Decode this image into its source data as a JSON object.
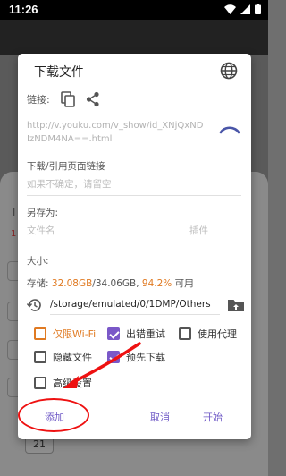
{
  "status_bar": {
    "time": "11:26"
  },
  "dialog": {
    "title": "下载文件",
    "link_label": "链接:",
    "url": "http://v.youku.com/v_show/id_XNjQxNDIzNDM4NA==.html",
    "referer_label": "下载/引用页面链接",
    "referer_placeholder": "如果不确定，请留空",
    "save_as_label": "另存为:",
    "filename_placeholder": "文件名",
    "plugin_placeholder": "插件",
    "size_label": "大小:",
    "storage": {
      "prefix": "存储: ",
      "free": "32.08GB",
      "total": "/34.06GB, ",
      "percent": "94.2%",
      "suffix": " 可用"
    },
    "path": "/storage/emulated/0/1DMP/Others",
    "options": {
      "wifi_only": {
        "label": "仅限Wi-Fi",
        "checked": false
      },
      "retry_on_error": {
        "label": "出错重试",
        "checked": true
      },
      "use_proxy": {
        "label": "使用代理",
        "checked": false
      },
      "hide_file": {
        "label": "隐藏文件",
        "checked": false
      },
      "pre_download": {
        "label": "预先下载",
        "checked": true
      },
      "advanced": {
        "label": "高级设置",
        "checked": false
      }
    },
    "buttons": {
      "add": "添加",
      "cancel": "取消",
      "start": "开始"
    }
  },
  "background": {
    "letter_1": "T",
    "letter_2": "1",
    "number_box": "21"
  },
  "colors": {
    "accent": "#7a58c8",
    "warning": "#e07a22",
    "annotation": "#e11111"
  }
}
